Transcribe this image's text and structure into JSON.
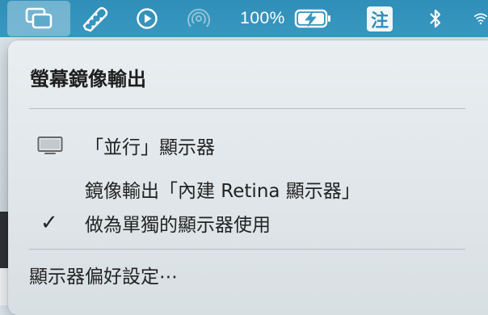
{
  "menubar": {
    "battery_percent": "100%",
    "ime_label": "注",
    "icons": [
      "screen-mirroring-icon",
      "script-pen-icon",
      "play-circle-icon",
      "airdrop-icon",
      "battery-charging-icon",
      "bluetooth-icon",
      "wifi-icon"
    ]
  },
  "menu": {
    "title": "螢幕鏡像輸出",
    "items": [
      {
        "label": "「並行」顯示器",
        "icon": "display-icon",
        "checked": false
      },
      {
        "label": "鏡像輸出「內建 Retina 顯示器」",
        "checked": false
      },
      {
        "label": "做為單獨的顯示器使用",
        "checked": true
      }
    ],
    "preferences_label": "顯示器偏好設定⋯",
    "check_glyph": "✓"
  },
  "colors": {
    "menubar": "#3a98c0",
    "menu_bg": "#e6ecef",
    "text": "#222222"
  }
}
